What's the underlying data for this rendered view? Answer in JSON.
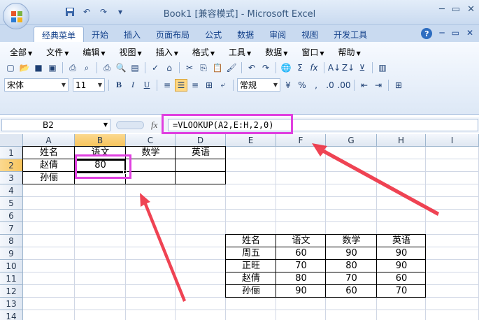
{
  "window": {
    "title": "Book1 [兼容模式] - Microsoft Excel"
  },
  "quick_access": {
    "icons": [
      "save-icon",
      "undo-icon",
      "redo-icon",
      "customize-icon"
    ]
  },
  "tabs": [
    {
      "label": "经典菜单",
      "active": true
    },
    {
      "label": "开始"
    },
    {
      "label": "插入"
    },
    {
      "label": "页面布局"
    },
    {
      "label": "公式"
    },
    {
      "label": "数据"
    },
    {
      "label": "审阅"
    },
    {
      "label": "视图"
    },
    {
      "label": "开发工具"
    }
  ],
  "menu": [
    "全部",
    "文件",
    "编辑",
    "视图",
    "插入",
    "格式",
    "工具",
    "数据",
    "窗口",
    "帮助"
  ],
  "toolbar": {
    "font_name": "宋体",
    "font_size": "11",
    "bold": "B",
    "italic": "I",
    "underline": "U",
    "number_format": "常规",
    "percent": "%",
    "comma": ","
  },
  "formula_bar": {
    "name_box": "B2",
    "fx": "fx",
    "formula": "=VLOOKUP(A2,E:H,2,0)"
  },
  "columns": [
    "A",
    "B",
    "C",
    "D",
    "E",
    "F",
    "G",
    "H",
    "I"
  ],
  "rows": [
    "1",
    "2",
    "3",
    "4",
    "5",
    "6",
    "7",
    "8",
    "9",
    "10",
    "11",
    "12",
    "13",
    "14"
  ],
  "sheet": {
    "active_cell": "B2",
    "table1": {
      "headers": [
        "姓名",
        "语文",
        "数学",
        "英语"
      ],
      "rows": [
        [
          "赵倩",
          "80",
          "",
          ""
        ],
        [
          "孙俪",
          "",
          "",
          ""
        ]
      ]
    },
    "table2": {
      "headers": [
        "姓名",
        "语文",
        "数学",
        "英语"
      ],
      "rows": [
        [
          "周五",
          "60",
          "90",
          "90"
        ],
        [
          "正旺",
          "70",
          "80",
          "90"
        ],
        [
          "赵倩",
          "80",
          "70",
          "60"
        ],
        [
          "孙俪",
          "90",
          "60",
          "70"
        ]
      ]
    }
  },
  "colors": {
    "highlight": "#e040e0",
    "arrow": "#ee3344"
  }
}
